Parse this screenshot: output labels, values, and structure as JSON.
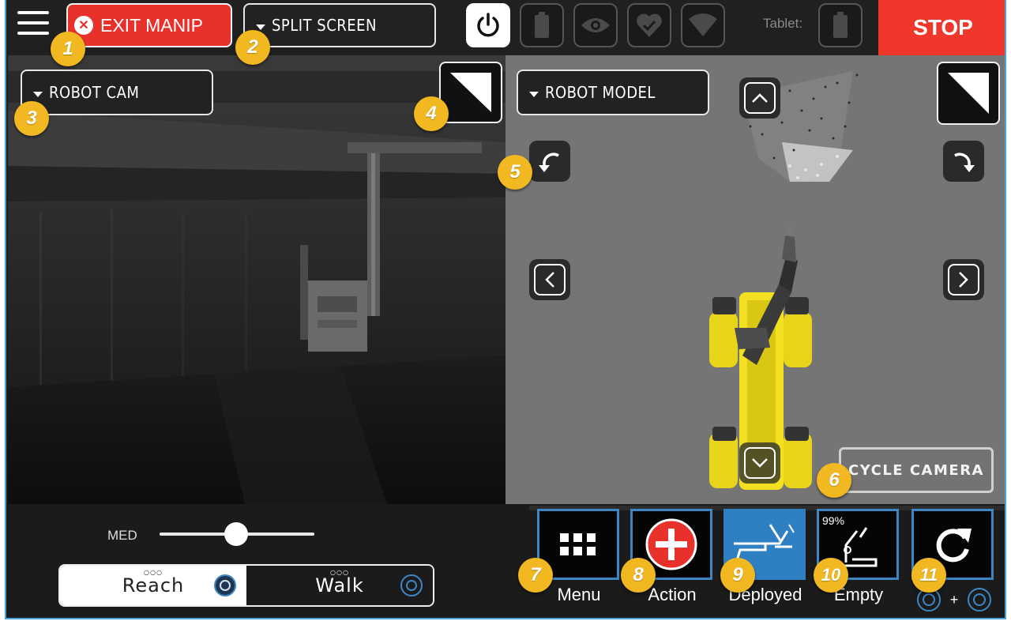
{
  "topbar": {
    "exit_label": "EXIT MANIP",
    "split_label": "SPLIT SCREEN",
    "tablet_label": "Tablet:",
    "stop_label": "STOP"
  },
  "left_pane": {
    "camera_label": "ROBOT CAM"
  },
  "right_pane": {
    "view_label": "ROBOT MODEL",
    "cycle_label": "CYCLE CAMERA"
  },
  "bottom": {
    "speed_label": "MED",
    "speed_level": 0.5,
    "modes": [
      {
        "label": "Reach",
        "active": true
      },
      {
        "label": "Walk",
        "active": false
      }
    ],
    "actions": [
      {
        "label": "Menu"
      },
      {
        "label": "Action"
      },
      {
        "label": "Deployed"
      },
      {
        "label": "Empty",
        "percent": "99%"
      },
      {
        "plus": "+"
      }
    ]
  },
  "badges": [
    "1",
    "2",
    "3",
    "4",
    "5",
    "6",
    "7",
    "8",
    "9",
    "10",
    "11"
  ],
  "colors": {
    "stop_red": "#f0372c",
    "exit_red": "#e8312a",
    "badge_yellow": "#f2b822",
    "accent_blue": "#3d86c6",
    "robot_yellow": "#f2e021"
  }
}
